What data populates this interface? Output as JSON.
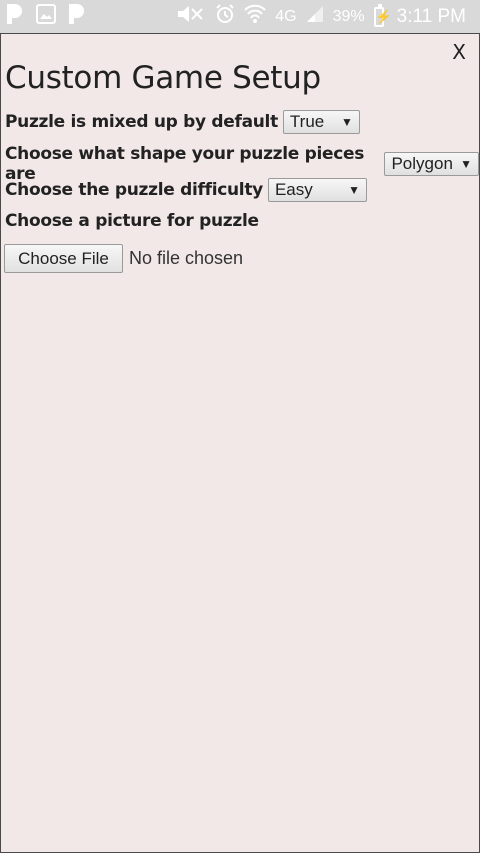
{
  "status_bar": {
    "left_icons": [
      "pandora-icon",
      "image-icon",
      "pandora-icon"
    ],
    "right_icons": [
      "mute-icon",
      "alarm-icon",
      "wifi-icon",
      "lte-icon",
      "signal-icon"
    ],
    "network": "4G",
    "battery": "39%",
    "time": "3:11 PM"
  },
  "dialog": {
    "close_label": "X",
    "title": "Custom Game Setup",
    "fields": [
      {
        "label": "Puzzle is mixed up by default",
        "value": "True"
      },
      {
        "label": "Choose what shape your puzzle pieces are",
        "value": "Polygon"
      },
      {
        "label": "Choose the puzzle difficulty",
        "value": "Easy"
      }
    ],
    "picture_label": "Choose a picture for puzzle",
    "file_button": "Choose File",
    "file_status": "No file chosen"
  },
  "colors": {
    "background": "#f2e8e8",
    "status_bar": "#d9d9d9",
    "text": "#222222"
  }
}
